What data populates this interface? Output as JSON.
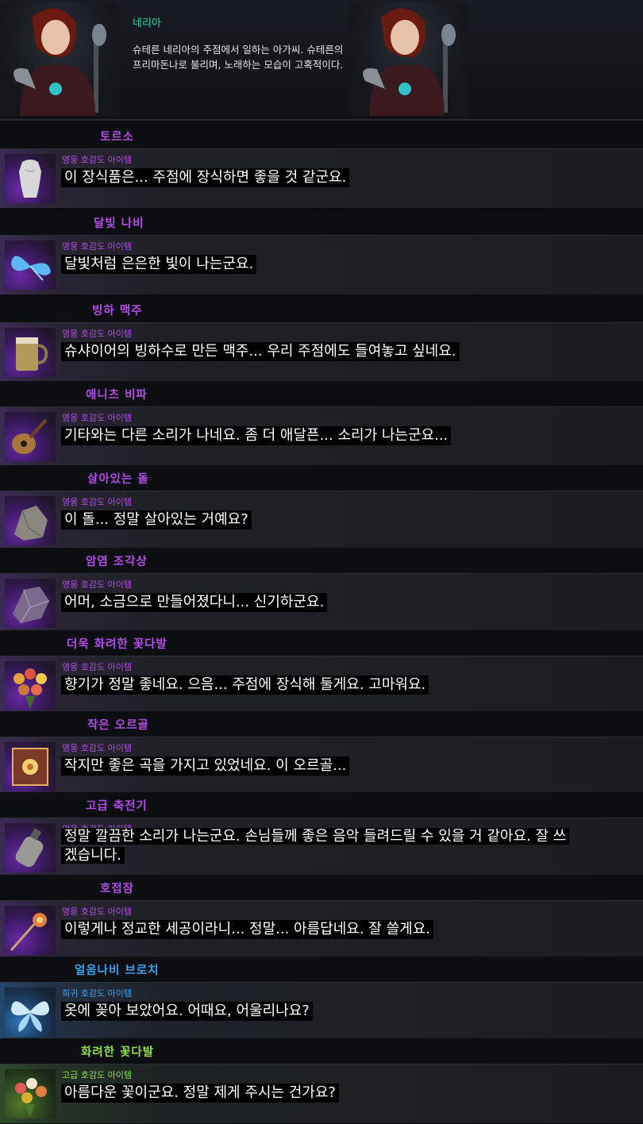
{
  "npc": {
    "name": "네리아",
    "description": "슈테른 네리아의 주점에서 일하는 아가씨. 슈테른의 프리마돈나로 불리며, 노래하는 모습이 고혹적이다."
  },
  "colors": {
    "npc_name": "#27d9a6",
    "hero": "#b14de8",
    "rare": "#3aa4f0",
    "high": "#8ee04b"
  },
  "items": [
    {
      "name": "토르소",
      "grade": "영웅 호감도 아이템",
      "grade_type": "hero",
      "dialog": "이 장식품은... 주점에 장식하면 좋을 것 같군요.",
      "icon": "torso-icon"
    },
    {
      "name": "달빛 나비",
      "grade": "영웅 호감도 아이템",
      "grade_type": "hero",
      "dialog": "달빛처럼 은은한 빛이 나는군요.",
      "icon": "moonlight-butterfly-icon"
    },
    {
      "name": "빙하 맥주",
      "grade": "영웅 호감도 아이템",
      "grade_type": "hero",
      "dialog": "슈샤이어의 빙하수로 만든 맥주... 우리 주점에도 들여놓고 싶네요.",
      "icon": "beer-mug-icon"
    },
    {
      "name": "애니츠 비파",
      "grade": "영웅 호감도 아이템",
      "grade_type": "hero",
      "dialog": "기타와는 다른 소리가 나네요. 좀 더 애달픈... 소리가 나는군요...",
      "icon": "lute-icon"
    },
    {
      "name": "살아있는 돌",
      "grade": "영웅 호감도 아이템",
      "grade_type": "hero",
      "dialog": "이 돌... 정말 살아있는 거예요?",
      "icon": "living-stone-icon"
    },
    {
      "name": "암염 조각상",
      "grade": "영웅 호감도 아이템",
      "grade_type": "hero",
      "dialog": "어머, 소금으로 만들어졌다니... 신기하군요.",
      "icon": "rock-salt-statue-icon"
    },
    {
      "name": "더욱 화려한 꽃다발",
      "grade": "영웅 호감도 아이템",
      "grade_type": "hero",
      "dialog": "향기가 정말 좋네요. 으음... 주점에 장식해 둘게요. 고마워요.",
      "icon": "bouquet-icon"
    },
    {
      "name": "작은 오르골",
      "grade": "영웅 호감도 아이템",
      "grade_type": "hero",
      "dialog": "작지만 좋은 곡을 가지고 있었네요. 이 오르골...",
      "icon": "music-box-icon"
    },
    {
      "name": "고급 축전기",
      "grade": "영웅 호감도 아이템",
      "grade_type": "hero",
      "dialog_line1": "정말 깔끔한 소리가 나는군요. 손님들께 좋은 음악 들려드릴 수 있을 거 같아요. 잘 쓰",
      "dialog_line2": "겠습니다.",
      "icon": "capacitor-icon"
    },
    {
      "name": "호접잠",
      "grade": "영웅 호감도 아이템",
      "grade_type": "hero",
      "dialog": "이렇게나 정교한 세공이라니... 정말... 아름답네요. 잘 쓸게요.",
      "icon": "butterfly-hairpin-icon"
    },
    {
      "name": "얼음나비 브로치",
      "grade": "희귀 호감도 아이템",
      "grade_type": "rare",
      "dialog": "옷에 꽂아 보았어요. 어때요, 어울리나요?",
      "icon": "ice-butterfly-brooch-icon"
    },
    {
      "name": "화려한 꽃다발",
      "grade": "고급 호감도 아이템",
      "grade_type": "high",
      "dialog": "아름다운 꽃이군요. 정말 제게 주시는 건가요?",
      "icon": "flower-bouquet-icon"
    }
  ]
}
